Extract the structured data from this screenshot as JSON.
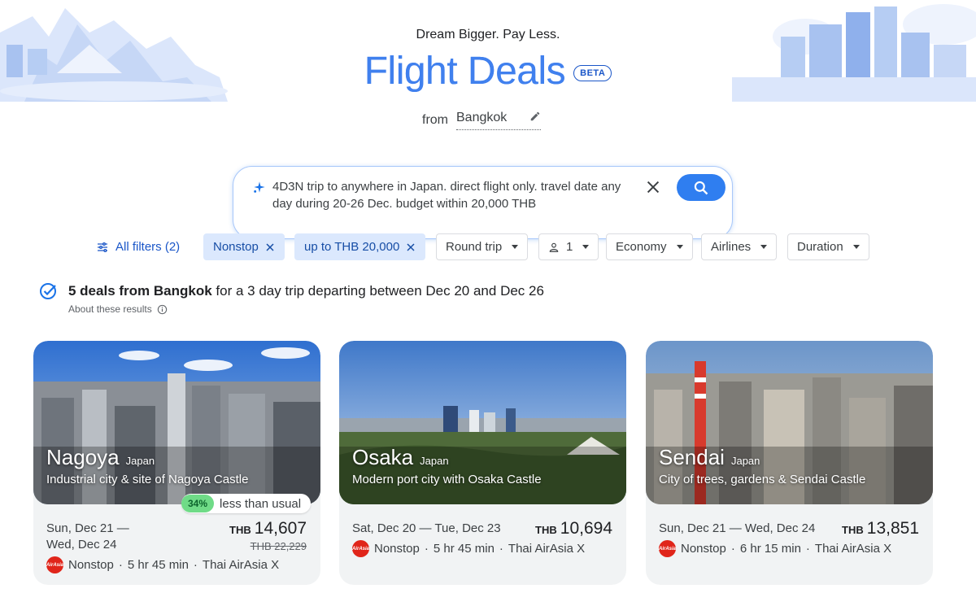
{
  "header": {
    "tagline": "Dream Bigger. Pay Less.",
    "title": "Flight Deals",
    "badge": "BETA",
    "from_label": "from",
    "origin": "Bangkok"
  },
  "search": {
    "query": "4D3N trip to anywhere in Japan. direct flight only. travel date any day during 20-26 Dec. budget within 20,000 THB"
  },
  "filters": {
    "all_filters": "All filters (2)",
    "nonstop": "Nonstop",
    "budget": "up to THB 20,000",
    "trip_type": "Round trip",
    "passengers": "1",
    "cabin": "Economy",
    "airlines": "Airlines",
    "duration": "Duration"
  },
  "results": {
    "count_label": "5 deals from Bangkok",
    "summary": " for a 3 day trip departing between Dec 20 and Dec 26",
    "about": "About these results"
  },
  "cards": [
    {
      "city": "Nagoya",
      "country": "Japan",
      "description": "Industrial city & site of Nagoya Castle",
      "discount_pct": "34%",
      "discount_label": "less than usual",
      "dates_line1": "Sun, Dec 21 —",
      "dates_line2": "Wed, Dec 24",
      "currency": "THB",
      "price": "14,607",
      "old_price": "THB 22,229",
      "stops": "Nonstop",
      "duration": "5 hr 45 min",
      "airline": "Thai AirAsia X"
    },
    {
      "city": "Osaka",
      "country": "Japan",
      "description": "Modern port city with Osaka Castle",
      "dates_line1": "Sat, Dec 20 — Tue, Dec 23",
      "currency": "THB",
      "price": "10,694",
      "stops": "Nonstop",
      "duration": "5 hr 45 min",
      "airline": "Thai AirAsia X"
    },
    {
      "city": "Sendai",
      "country": "Japan",
      "description": "City of trees, gardens & Sendai Castle",
      "dates_line1": "Sun, Dec 21 — Wed, Dec 24",
      "currency": "THB",
      "price": "13,851",
      "stops": "Nonstop",
      "duration": "6 hr 15 min",
      "airline": "Thai AirAsia X"
    }
  ],
  "airline_logo_text": "AirAsia",
  "separator": "·",
  "colors": {
    "accent": "#1a73e8",
    "title_blue": "#4080ee",
    "active_chip": "#dbe8fd",
    "discount_green": "#6fdb87",
    "airline_red": "#e0251a"
  }
}
